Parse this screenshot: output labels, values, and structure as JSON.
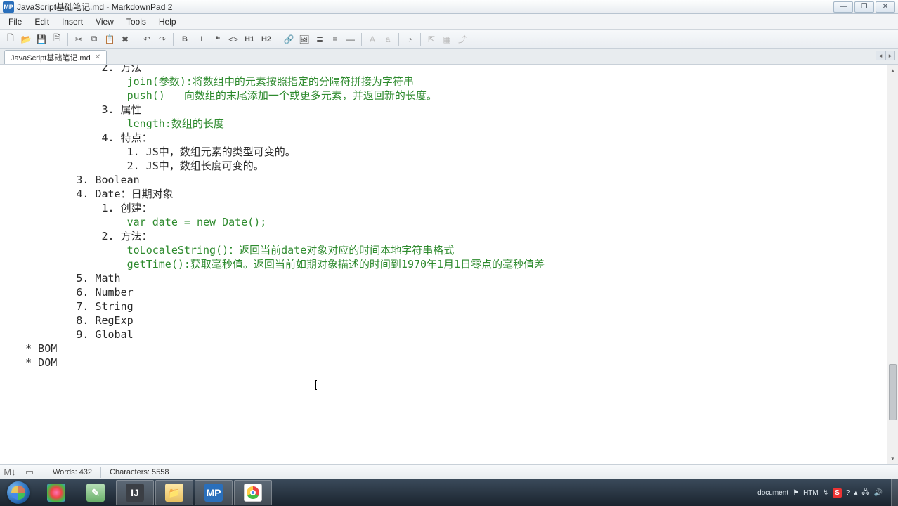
{
  "titlebar": {
    "app_badge": "MP",
    "title": "JavaScript基础笔记.md - MarkdownPad 2"
  },
  "menubar": {
    "items": [
      "File",
      "Edit",
      "Insert",
      "View",
      "Tools",
      "Help"
    ]
  },
  "toolbar": {
    "buttons": [
      {
        "name": "new-file-icon",
        "glyph": "🗋"
      },
      {
        "name": "open-file-icon",
        "glyph": "📂"
      },
      {
        "name": "save-icon",
        "glyph": "💾"
      },
      {
        "name": "save-all-icon",
        "glyph": "🗎"
      },
      {
        "sep": true
      },
      {
        "name": "cut-icon",
        "glyph": "✂"
      },
      {
        "name": "copy-icon",
        "glyph": "⧉"
      },
      {
        "name": "paste-icon",
        "glyph": "📋"
      },
      {
        "name": "delete-icon",
        "glyph": "✖"
      },
      {
        "sep": true
      },
      {
        "name": "undo-icon",
        "glyph": "↶"
      },
      {
        "name": "redo-icon",
        "glyph": "↷"
      },
      {
        "sep": true
      },
      {
        "name": "bold-icon",
        "glyph": "B",
        "wide": true
      },
      {
        "name": "italic-icon",
        "glyph": "I",
        "wide": true
      },
      {
        "name": "quote-icon",
        "glyph": "❝"
      },
      {
        "name": "code-icon",
        "glyph": "<>"
      },
      {
        "name": "h1-icon",
        "glyph": "H1",
        "wide": true
      },
      {
        "name": "h2-icon",
        "glyph": "H2",
        "wide": true
      },
      {
        "sep": true
      },
      {
        "name": "link-icon",
        "glyph": "🔗"
      },
      {
        "name": "image-icon",
        "glyph": "🖼"
      },
      {
        "name": "ul-icon",
        "glyph": "≣"
      },
      {
        "name": "ol-icon",
        "glyph": "≡"
      },
      {
        "name": "hr-icon",
        "glyph": "―"
      },
      {
        "sep": true
      },
      {
        "name": "font-a-icon",
        "glyph": "A",
        "disabled": true
      },
      {
        "name": "font-a-small-icon",
        "glyph": "a",
        "disabled": true
      },
      {
        "sep": true
      },
      {
        "name": "timestamp-icon",
        "glyph": "◔"
      },
      {
        "sep": true
      },
      {
        "name": "preview-icon",
        "glyph": "⇱",
        "disabled": true
      },
      {
        "name": "split-icon",
        "glyph": "▦",
        "disabled": true
      },
      {
        "name": "export-icon",
        "glyph": "⤴",
        "disabled": true
      }
    ]
  },
  "tabs": {
    "items": [
      {
        "label": "JavaScript基础笔记.md"
      }
    ]
  },
  "editor": {
    "lines": [
      {
        "indent": "                ",
        "num": "2. ",
        "text": "方法",
        "partial_top": true
      },
      {
        "indent": "                    ",
        "code": "join(参数):将数组中的元素按照指定的分隔符拼接为字符串"
      },
      {
        "indent": "                    ",
        "code": "push()   向数组的末尾添加一个或更多元素，并返回新的长度。"
      },
      {
        "indent": "                ",
        "num": "3. ",
        "text": "属性"
      },
      {
        "indent": "                    ",
        "code": "length:数组的长度"
      },
      {
        "indent": "                ",
        "num": "4. ",
        "text": "特点："
      },
      {
        "indent": "                    ",
        "num": "1. ",
        "text": "JS中，数组元素的类型可变的。"
      },
      {
        "indent": "                    ",
        "num": "2. ",
        "text": "JS中，数组长度可变的。"
      },
      {
        "indent": "            ",
        "num": "3. ",
        "text": "Boolean"
      },
      {
        "indent": "            ",
        "num": "4. ",
        "text": "Date：日期对象"
      },
      {
        "indent": "                ",
        "num": "1. ",
        "text": "创建："
      },
      {
        "indent": "                    ",
        "code": "var date = new Date();"
      },
      {
        "indent": "",
        "text": ""
      },
      {
        "indent": "                ",
        "num": "2. ",
        "text": "方法："
      },
      {
        "indent": "                    ",
        "code": "toLocaleString()：返回当前date对象对应的时间本地字符串格式"
      },
      {
        "indent": "                    ",
        "code": "getTime():获取毫秒值。返回当前如期对象描述的时间到1970年1月1日零点的毫秒值差"
      },
      {
        "indent": "            ",
        "num": "5. ",
        "text": "Math"
      },
      {
        "indent": "            ",
        "num": "6. ",
        "text": "Number"
      },
      {
        "indent": "            ",
        "num": "7. ",
        "text": "String"
      },
      {
        "indent": "            ",
        "num": "8. ",
        "text": "RegExp"
      },
      {
        "indent": "            ",
        "num": "9. ",
        "text": "Global"
      },
      {
        "indent": "",
        "text": ""
      },
      {
        "indent": "    ",
        "text": "* BOM",
        "caret_after": true
      },
      {
        "indent": "",
        "text": ""
      },
      {
        "indent": "    ",
        "text": "* DOM"
      }
    ]
  },
  "status": {
    "words_label": "Words: 432",
    "chars_label": "Characters: 5558"
  },
  "taskbar": {
    "apps": [
      {
        "name": "tool-1",
        "bg": "radial-gradient(#f7b 0,#e44 40%,#4b4 70%,#48e)",
        "glyph": ""
      },
      {
        "name": "notepad",
        "bg": "linear-gradient(#b8e0b8,#6ab06a)",
        "glyph": "✎"
      },
      {
        "name": "intellij",
        "bg": "#3b3f45",
        "glyph": "IJ",
        "active": true
      },
      {
        "name": "explorer",
        "bg": "linear-gradient(#ffe9a8,#e8c060)",
        "glyph": "📁",
        "active": true
      },
      {
        "name": "markdownpad",
        "bg": "#2a6fbb",
        "glyph": "MP",
        "active": true
      },
      {
        "name": "chrome",
        "bg": "#fff",
        "glyph": "◉",
        "active": true
      }
    ],
    "tray_items": [
      {
        "name": "document-label",
        "text": "document"
      },
      {
        "name": "flag-icon",
        "text": "⚑"
      },
      {
        "name": "htm-label",
        "text": "HTM"
      },
      {
        "name": "arrow-icon",
        "text": "↯"
      },
      {
        "name": "sogou-icon",
        "text": "S",
        "bg": "#e33"
      },
      {
        "name": "help-icon",
        "text": "?"
      },
      {
        "name": "up-icon",
        "text": "▴"
      },
      {
        "name": "network-icon",
        "text": "🖧"
      },
      {
        "name": "volume-icon",
        "text": "🔊"
      }
    ],
    "clock": {
      "time": " ",
      "date": " "
    }
  }
}
